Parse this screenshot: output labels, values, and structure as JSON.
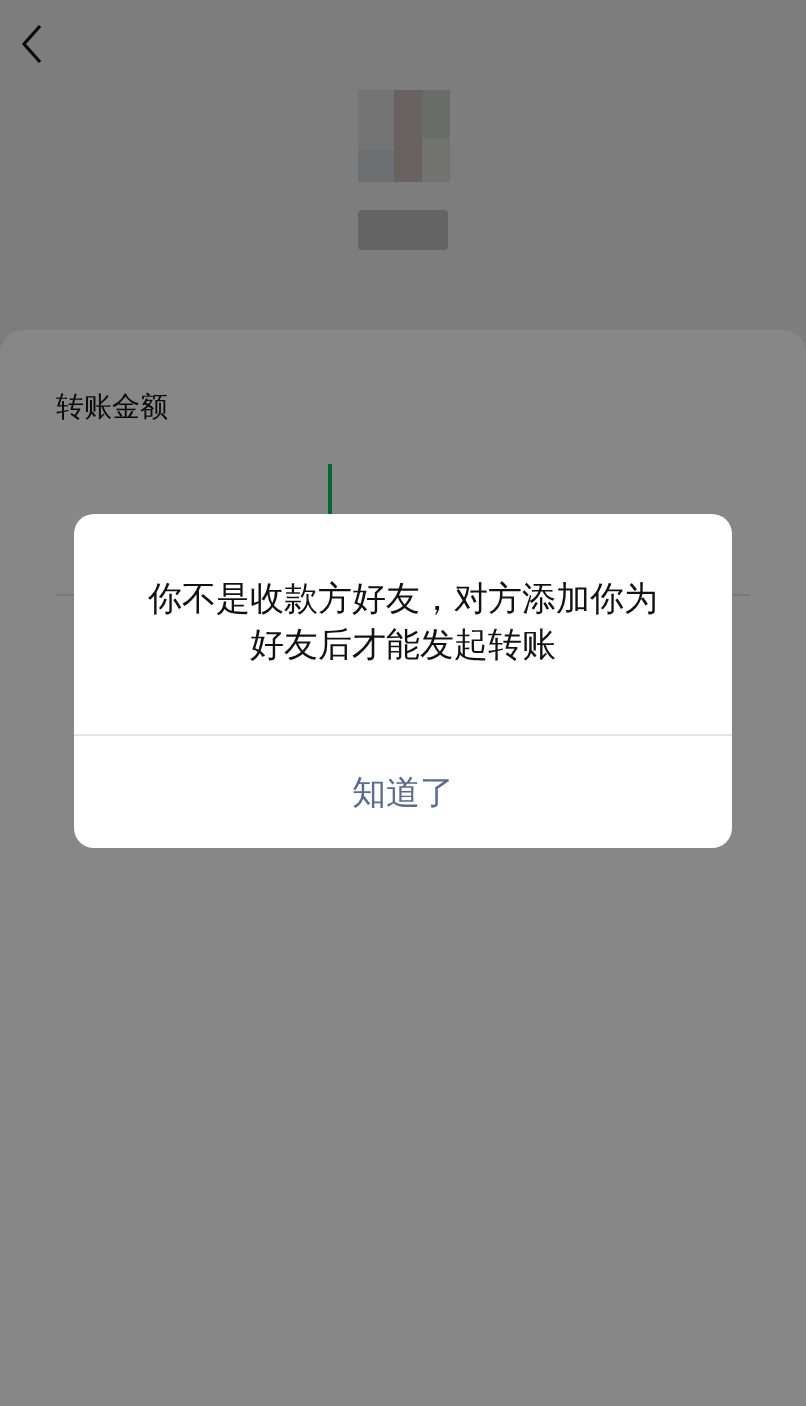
{
  "card": {
    "label": "转账金额"
  },
  "dialog": {
    "message": "你不是收款方好友，对方添加你为好友后才能发起转账",
    "button": "知道了"
  }
}
